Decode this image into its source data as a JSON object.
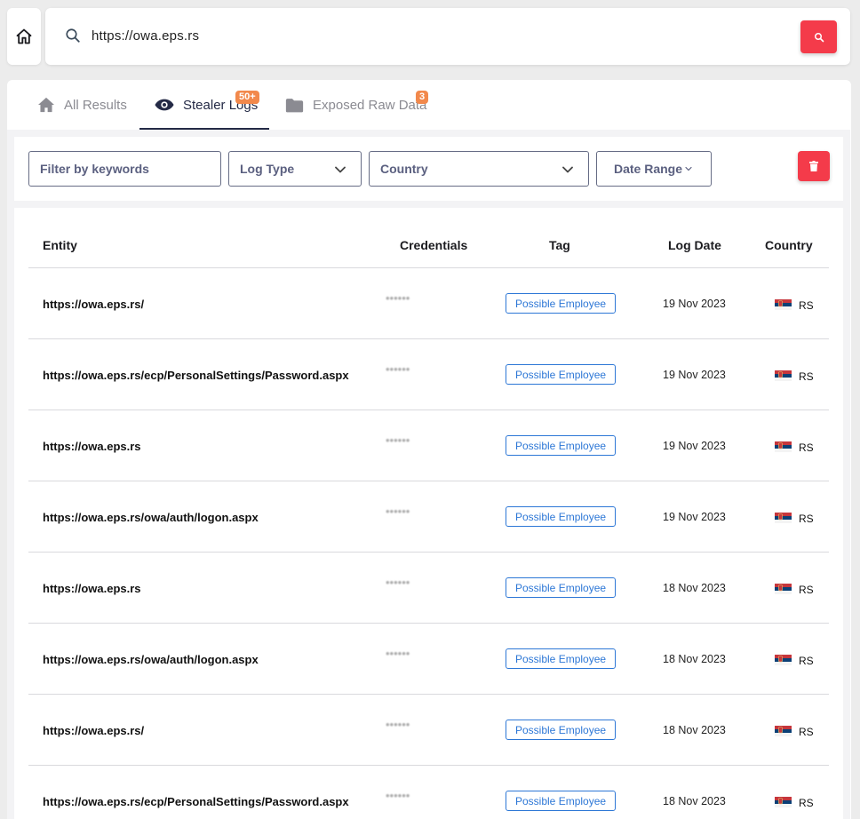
{
  "search": {
    "query": "https://owa.eps.rs"
  },
  "tabs": [
    {
      "label": "All Results",
      "icon": "home-icon"
    },
    {
      "label": "Stealer Logs",
      "icon": "eye-icon",
      "badge": "50+"
    },
    {
      "label": "Exposed Raw Data",
      "icon": "folder-icon",
      "badge": "3"
    }
  ],
  "filters": {
    "keywords_placeholder": "Filter by keywords",
    "log_type": "Log Type",
    "country": "Country",
    "date_range": "Date Range"
  },
  "table": {
    "headers": {
      "entity": "Entity",
      "credentials": "Credentials",
      "tag": "Tag",
      "log_date": "Log Date",
      "country": "Country"
    },
    "rows": [
      {
        "entity": "https://owa.eps.rs/",
        "credentials": "••••••",
        "tag": "Possible Employee",
        "date": "19 Nov 2023",
        "country": "RS"
      },
      {
        "entity": "https://owa.eps.rs/ecp/PersonalSettings/Password.aspx",
        "credentials": "••••••",
        "tag": "Possible Employee",
        "date": "19 Nov 2023",
        "country": "RS"
      },
      {
        "entity": "https://owa.eps.rs",
        "credentials": "••••••",
        "tag": "Possible Employee",
        "date": "19 Nov 2023",
        "country": "RS"
      },
      {
        "entity": "https://owa.eps.rs/owa/auth/logon.aspx",
        "credentials": "••••••",
        "tag": "Possible Employee",
        "date": "19 Nov 2023",
        "country": "RS"
      },
      {
        "entity": "https://owa.eps.rs",
        "credentials": "••••••",
        "tag": "Possible Employee",
        "date": "18 Nov 2023",
        "country": "RS"
      },
      {
        "entity": "https://owa.eps.rs/owa/auth/logon.aspx",
        "credentials": "••••••",
        "tag": "Possible Employee",
        "date": "18 Nov 2023",
        "country": "RS"
      },
      {
        "entity": "https://owa.eps.rs/",
        "credentials": "••••••",
        "tag": "Possible Employee",
        "date": "18 Nov 2023",
        "country": "RS"
      },
      {
        "entity": "https://owa.eps.rs/ecp/PersonalSettings/Password.aspx",
        "credentials": "••••••",
        "tag": "Possible Employee",
        "date": "18 Nov 2023",
        "country": "RS"
      }
    ]
  },
  "colors": {
    "accent_red": "#f43b4a",
    "badge_orange": "#f2894c",
    "tag_blue": "#2d77d6",
    "nav_dark": "#242a46"
  }
}
